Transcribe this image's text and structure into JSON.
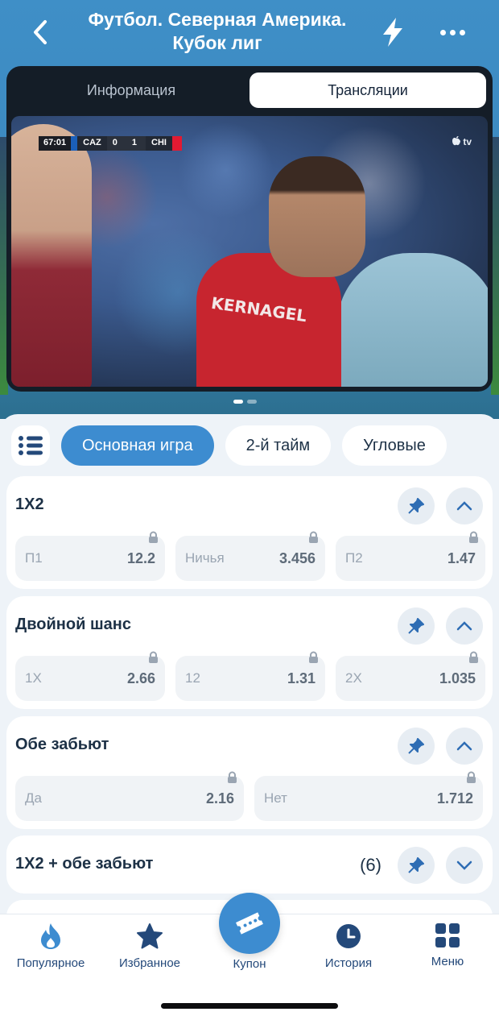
{
  "header": {
    "title": "Футбол. Северная Америка. Кубок лиг",
    "icons": [
      "chevron-left-icon",
      "lightning-icon",
      "more-icon"
    ]
  },
  "video": {
    "tabs": [
      {
        "label": "Информация",
        "active": false
      },
      {
        "label": "Трансляции",
        "active": true
      }
    ],
    "scoreboard": {
      "time": "67:01",
      "home": "CAZ",
      "home_score": "0",
      "away_score": "1",
      "away": "CHI"
    },
    "broadcaster": "tv",
    "jersey_text": "KERNAGEL",
    "pager": {
      "count": 2,
      "active": 0
    }
  },
  "filters": {
    "chips": [
      {
        "label": "Основная игра",
        "active": true
      },
      {
        "label": "2-й тайм",
        "active": false
      },
      {
        "label": "Угловые",
        "active": false
      }
    ]
  },
  "markets": [
    {
      "title": "1X2",
      "expanded": true,
      "count": "",
      "odds": [
        {
          "label": "П1",
          "value": "12.2"
        },
        {
          "label": "Ничья",
          "value": "3.456"
        },
        {
          "label": "П2",
          "value": "1.47"
        }
      ]
    },
    {
      "title": "Двойной шанс",
      "expanded": true,
      "count": "",
      "odds": [
        {
          "label": "1X",
          "value": "2.66"
        },
        {
          "label": "12",
          "value": "1.31"
        },
        {
          "label": "2X",
          "value": "1.035"
        }
      ]
    },
    {
      "title": "Обе забьют",
      "expanded": true,
      "count": "",
      "odds": [
        {
          "label": "Да",
          "value": "2.16"
        },
        {
          "label": "Нет",
          "value": "1.712"
        }
      ]
    },
    {
      "title": "1X2 + обе забьют",
      "expanded": false,
      "count": "(6)",
      "odds": []
    }
  ],
  "tabbar": {
    "items": [
      {
        "label": "Популярное",
        "icon": "fire-icon"
      },
      {
        "label": "Избранное",
        "icon": "star-icon"
      },
      {
        "label": "Купон",
        "icon": "ticket-icon"
      },
      {
        "label": "История",
        "icon": "clock-icon"
      },
      {
        "label": "Меню",
        "icon": "grid-icon"
      }
    ]
  },
  "colors": {
    "accent": "#3d8cd0",
    "header_bg": "#3f8fc7",
    "tab_text": "#24497a",
    "odds_bg": "#f0f3f6"
  }
}
